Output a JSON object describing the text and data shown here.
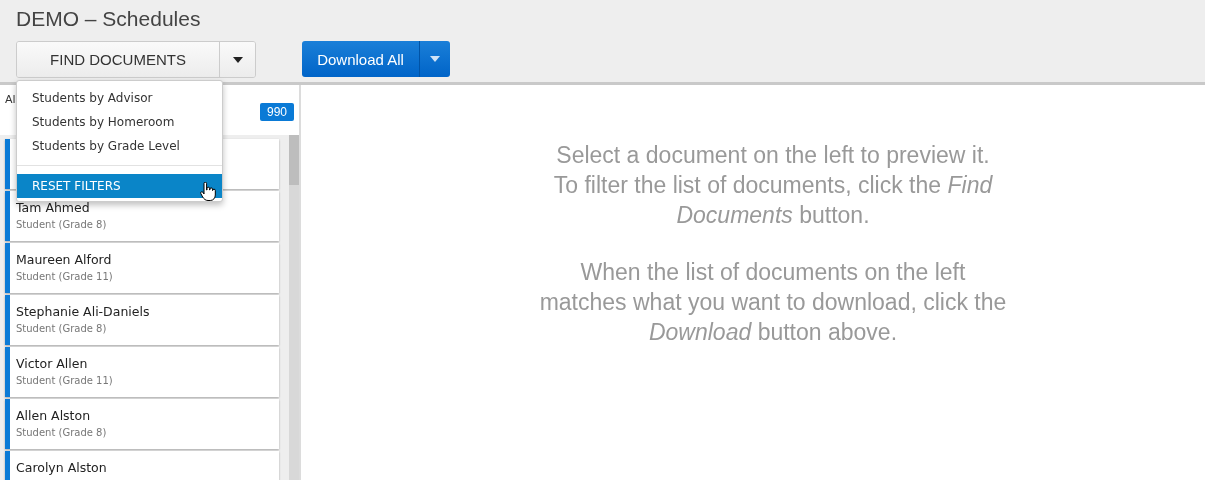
{
  "window": {
    "title": "DEMO – Schedules"
  },
  "toolbar": {
    "find_button": "FIND DOCUMENTS",
    "download_button": "Download All"
  },
  "find_menu": {
    "items": [
      {
        "label": "Students by Advisor",
        "selected": false
      },
      {
        "label": "Students by Homeroom",
        "selected": false
      },
      {
        "label": "Students by Grade Level",
        "selected": false
      },
      {
        "label": "RESET FILTERS",
        "selected": true
      }
    ]
  },
  "sidebar": {
    "header_fragment": "Al",
    "count": "990",
    "documents": [
      {
        "name": "Tam Ahmed",
        "detail": "Student (Grade 8)"
      },
      {
        "name": "Maureen Alford",
        "detail": "Student (Grade 11)"
      },
      {
        "name": "Stephanie Ali-Daniels",
        "detail": "Student (Grade 8)"
      },
      {
        "name": "Victor Allen",
        "detail": "Student (Grade 11)"
      },
      {
        "name": "Allen Alston",
        "detail": "Student (Grade 8)"
      },
      {
        "name": "Carolyn Alston"
      }
    ]
  },
  "preview": {
    "paragraphs": [
      [
        "Select a document on the left to preview it.",
        "To filter the list of documents, click the *Find Documents* button."
      ],
      [
        "When the list of documents on the left",
        "matches what you want to download, click the",
        "*Download* button above."
      ]
    ]
  }
}
